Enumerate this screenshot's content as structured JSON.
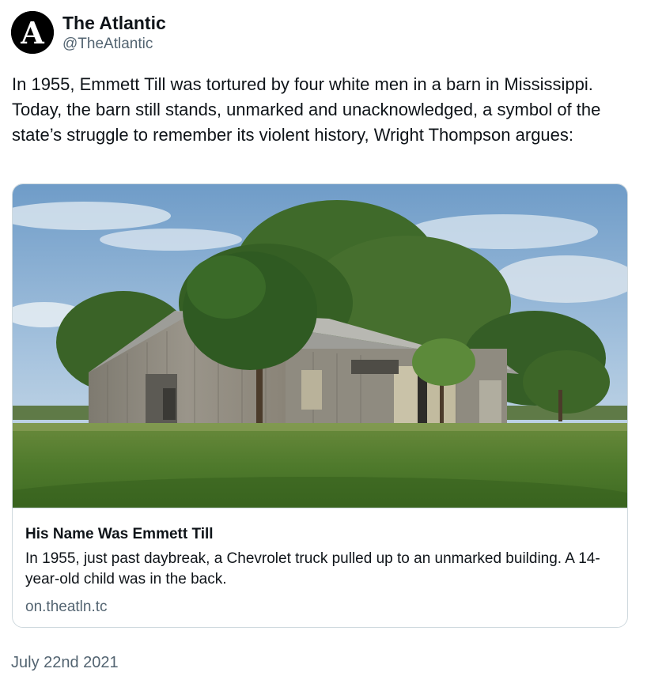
{
  "account": {
    "display_name": "The Atlantic",
    "handle": "@TheAtlantic",
    "avatar_letter": "A",
    "avatar_icon": "the-atlantic-logo"
  },
  "tweet": {
    "text": "In 1955, Emmett Till was tortured by four white men in a barn in Mississippi. Today, the barn still stands, unmarked and unacknowledged, a symbol of the state’s struggle to remember its violent history, Wright Thompson argues:",
    "date": "July 22nd 2021"
  },
  "card": {
    "image_description_icon": "photo-barn-under-trees",
    "title": "His Name Was Emmett Till",
    "description": "In 1955, just past daybreak, a Chevrolet truck pulled up to an unmarked building. A 14-year-old child was in the back.",
    "link": "on.theatln.tc"
  },
  "colors": {
    "text_primary": "#0f1419",
    "text_secondary": "#536471",
    "border": "#cfd9de",
    "avatar_bg": "#000000"
  }
}
